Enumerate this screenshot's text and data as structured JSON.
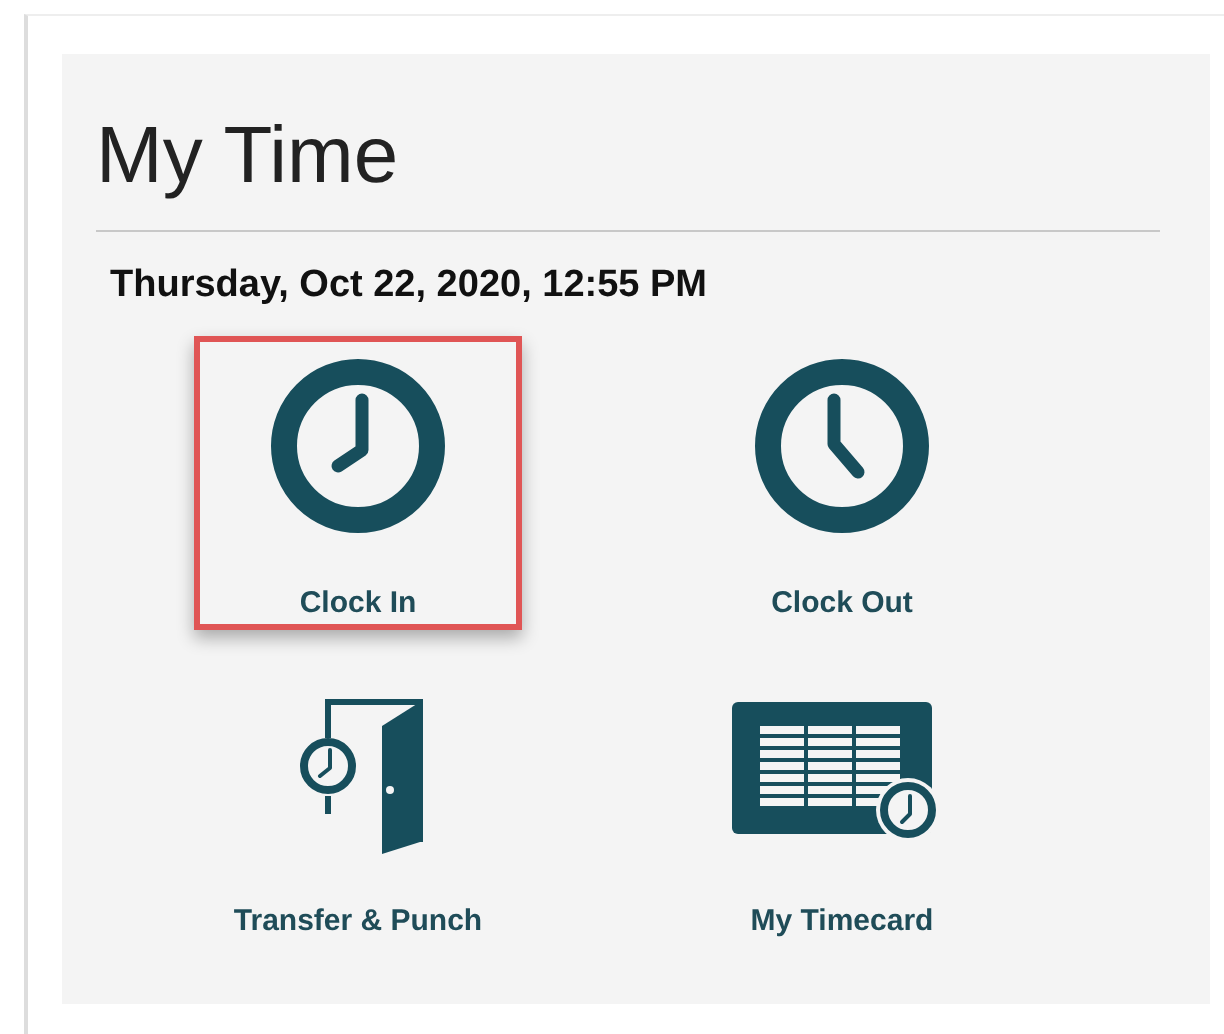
{
  "panel": {
    "title": "My Time",
    "datetime": "Thursday, Oct 22, 2020, 12:55 PM"
  },
  "tiles": [
    {
      "kind": "clock-in",
      "label": "Clock In",
      "highlighted": true
    },
    {
      "kind": "clock-out",
      "label": "Clock Out",
      "highlighted": false
    },
    {
      "kind": "transfer",
      "label": "Transfer & Punch",
      "highlighted": false
    },
    {
      "kind": "timecard",
      "label": "My Timecard",
      "highlighted": false
    }
  ]
}
